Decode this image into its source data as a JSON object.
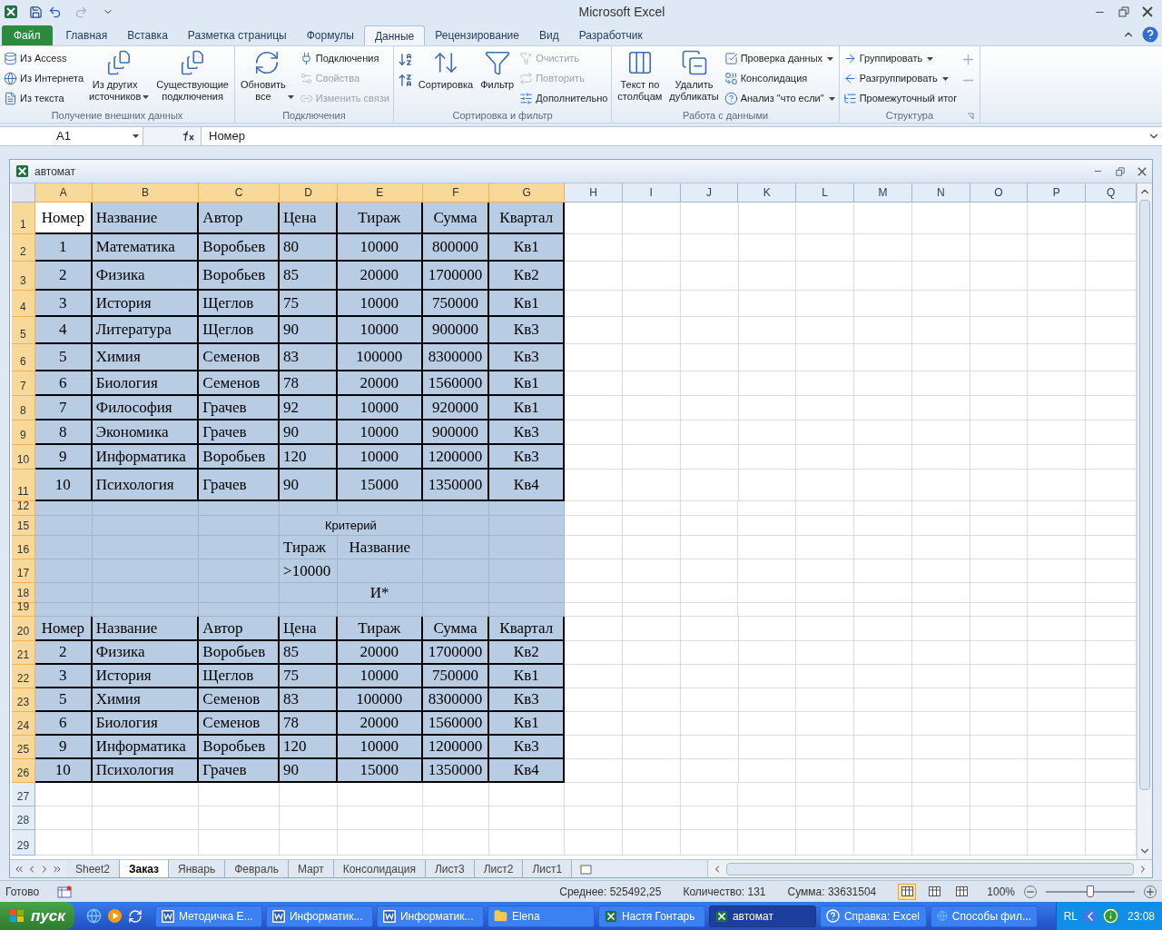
{
  "app": {
    "title": "Microsoft Excel"
  },
  "ribbon": {
    "tabs": [
      {
        "label": "Файл",
        "kind": "file",
        "selected": false
      },
      {
        "label": "Главная",
        "kind": "tab",
        "selected": false
      },
      {
        "label": "Вставка",
        "kind": "tab",
        "selected": false
      },
      {
        "label": "Разметка страницы",
        "kind": "tab",
        "selected": false
      },
      {
        "label": "Формулы",
        "kind": "tab",
        "selected": false
      },
      {
        "label": "Данные",
        "kind": "tab",
        "selected": true
      },
      {
        "label": "Рецензирование",
        "kind": "tab",
        "selected": false
      },
      {
        "label": "Вид",
        "kind": "tab",
        "selected": false
      },
      {
        "label": "Разработчик",
        "kind": "tab",
        "selected": false
      }
    ],
    "groups": [
      {
        "label": "Получение внешних данных",
        "launcher": false,
        "items": [
          {
            "kind": "stack",
            "items": [
              {
                "label": "Из Access",
                "disabled": false,
                "dropdown": false
              },
              {
                "label": "Из Интернета",
                "disabled": false,
                "dropdown": false
              },
              {
                "label": "Из текста",
                "disabled": false,
                "dropdown": false
              }
            ]
          },
          {
            "kind": "large",
            "label": "Из других\nисточников",
            "disabled": false,
            "dropdown": true
          },
          {
            "kind": "large",
            "label": "Существующие\nподключения",
            "disabled": false,
            "dropdown": false
          }
        ]
      },
      {
        "label": "Подключения",
        "launcher": false,
        "items": [
          {
            "kind": "large",
            "label": "Обновить\nвсе",
            "disabled": false,
            "dropdown": true
          },
          {
            "kind": "stack",
            "items": [
              {
                "label": "Подключения",
                "disabled": false,
                "dropdown": false
              },
              {
                "label": "Свойства",
                "disabled": true,
                "dropdown": false
              },
              {
                "label": "Изменить связи",
                "disabled": true,
                "dropdown": false
              }
            ]
          }
        ]
      },
      {
        "label": "Сортировка и фильтр",
        "launcher": false,
        "items": [
          {
            "kind": "icons",
            "items": [
              {
                "disabled": false
              },
              {
                "disabled": false
              }
            ]
          },
          {
            "kind": "large",
            "label": "Сортировка",
            "disabled": false,
            "dropdown": false
          },
          {
            "kind": "large",
            "label": "Фильтр",
            "disabled": false,
            "dropdown": false
          },
          {
            "kind": "stack",
            "items": [
              {
                "label": "Очистить",
                "disabled": true,
                "dropdown": false
              },
              {
                "label": "Повторить",
                "disabled": true,
                "dropdown": false
              },
              {
                "label": "Дополнительно",
                "disabled": false,
                "dropdown": false
              }
            ]
          }
        ]
      },
      {
        "label": "Работа с данными",
        "launcher": false,
        "items": [
          {
            "kind": "large",
            "label": "Текст по\nстолбцам",
            "disabled": false,
            "dropdown": false
          },
          {
            "kind": "large",
            "label": "Удалить\nдубликаты",
            "disabled": false,
            "dropdown": false
          },
          {
            "kind": "stack",
            "items": [
              {
                "label": "Проверка данных",
                "disabled": false,
                "dropdown": true
              },
              {
                "label": "Консолидация",
                "disabled": false,
                "dropdown": false
              },
              {
                "label": "Анализ \"что если\"",
                "disabled": false,
                "dropdown": true
              }
            ]
          }
        ]
      },
      {
        "label": "Структура",
        "launcher": true,
        "items": [
          {
            "kind": "stack",
            "items": [
              {
                "label": "Группировать",
                "disabled": false,
                "dropdown": true
              },
              {
                "label": "Разгруппировать",
                "disabled": false,
                "dropdown": true
              },
              {
                "label": "Промежуточный итог",
                "disabled": false,
                "dropdown": false
              }
            ]
          },
          {
            "kind": "icons",
            "items": [
              {
                "disabled": true
              },
              {
                "disabled": true
              }
            ]
          }
        ]
      }
    ]
  },
  "formula_bar": {
    "name_box": "A1",
    "formula": "Номер"
  },
  "workbook": {
    "title": "автомат",
    "grid": {
      "columns": [
        {
          "label": "A",
          "selected": true
        },
        {
          "label": "B",
          "selected": true
        },
        {
          "label": "C",
          "selected": true
        },
        {
          "label": "D",
          "selected": true
        },
        {
          "label": "E",
          "selected": true
        },
        {
          "label": "F",
          "selected": true
        },
        {
          "label": "G",
          "selected": true
        },
        {
          "label": "H",
          "selected": false
        },
        {
          "label": "I",
          "selected": false
        },
        {
          "label": "J",
          "selected": false
        },
        {
          "label": "K",
          "selected": false
        },
        {
          "label": "L",
          "selected": false
        },
        {
          "label": "M",
          "selected": false
        },
        {
          "label": "N",
          "selected": false
        },
        {
          "label": "O",
          "selected": false
        },
        {
          "label": "P",
          "selected": false
        },
        {
          "label": "Q",
          "selected": false
        }
      ],
      "rows": [
        {
          "label": "1",
          "selected": true,
          "kind": "header",
          "active": true,
          "cells": [
            "Номер",
            "Название",
            "Автор",
            "Цена",
            "Тираж",
            "Сумма",
            "Квартал"
          ]
        },
        {
          "label": "2",
          "selected": true,
          "kind": "data",
          "cells": [
            "1",
            "Математика",
            "Воробьев",
            "80",
            "10000",
            "800000",
            "Кв1"
          ]
        },
        {
          "label": "3",
          "selected": true,
          "kind": "data",
          "cells": [
            "2",
            "Физика",
            "Воробьев",
            "85",
            "20000",
            "1700000",
            "Кв2"
          ]
        },
        {
          "label": "4",
          "selected": true,
          "kind": "data",
          "cells": [
            "3",
            "История",
            "Щеглов",
            "75",
            "10000",
            "750000",
            "Кв1"
          ]
        },
        {
          "label": "5",
          "selected": true,
          "kind": "data",
          "cells": [
            "4",
            "Литература",
            "Щеглов",
            "90",
            "10000",
            "900000",
            "Кв3"
          ]
        },
        {
          "label": "6",
          "selected": true,
          "kind": "data",
          "cells": [
            "5",
            "Химия",
            "Семенов",
            "83",
            "100000",
            "8300000",
            "Кв3"
          ]
        },
        {
          "label": "7",
          "selected": true,
          "kind": "data",
          "cells": [
            "6",
            "Биология",
            "Семенов",
            "78",
            "20000",
            "1560000",
            "Кв1"
          ]
        },
        {
          "label": "8",
          "selected": true,
          "kind": "data",
          "cells": [
            "7",
            "Философия",
            "Грачев",
            "92",
            "10000",
            "920000",
            "Кв1"
          ]
        },
        {
          "label": "9",
          "selected": true,
          "kind": "data",
          "cells": [
            "8",
            "Экономика",
            "Грачев",
            "90",
            "10000",
            "900000",
            "Кв3"
          ]
        },
        {
          "label": "10",
          "selected": true,
          "kind": "data",
          "cells": [
            "9",
            "Информатика",
            "Воробьев",
            "120",
            "10000",
            "1200000",
            "Кв3"
          ]
        },
        {
          "label": "11",
          "selected": true,
          "kind": "data",
          "cells": [
            "10",
            "Психология",
            "Грачев",
            "90",
            "15000",
            "1350000",
            "Кв4"
          ]
        },
        {
          "label": "12",
          "selected": true,
          "kind": "blank"
        },
        {
          "label": "15",
          "selected": true,
          "kind": "caption",
          "cells": [
            null,
            null,
            null,
            "Критерий",
            null,
            null,
            null
          ]
        },
        {
          "label": "16",
          "selected": true,
          "kind": "sparse",
          "cells": [
            null,
            null,
            null,
            "Тираж",
            "Название",
            null,
            null
          ]
        },
        {
          "label": "17",
          "selected": true,
          "kind": "sparse",
          "cells": [
            null,
            null,
            null,
            ">10000",
            null,
            null,
            null
          ]
        },
        {
          "label": "18",
          "selected": true,
          "kind": "sparse",
          "cells": [
            null,
            null,
            null,
            null,
            "И*",
            null,
            null
          ]
        },
        {
          "label": "19",
          "selected": true,
          "kind": "blank"
        },
        {
          "label": "20",
          "selected": true,
          "kind": "header",
          "cells": [
            "Номер",
            "Название",
            "Автор",
            "Цена",
            "Тираж",
            "Сумма",
            "Квартал"
          ]
        },
        {
          "label": "21",
          "selected": true,
          "kind": "data",
          "cells": [
            "2",
            "Физика",
            "Воробьев",
            "85",
            "20000",
            "1700000",
            "Кв2"
          ]
        },
        {
          "label": "22",
          "selected": true,
          "kind": "data",
          "cells": [
            "3",
            "История",
            "Щеглов",
            "75",
            "10000",
            "750000",
            "Кв1"
          ]
        },
        {
          "label": "23",
          "selected": true,
          "kind": "data",
          "cells": [
            "5",
            "Химия",
            "Семенов",
            "83",
            "100000",
            "8300000",
            "Кв3"
          ]
        },
        {
          "label": "24",
          "selected": true,
          "kind": "data",
          "cells": [
            "6",
            "Биология",
            "Семенов",
            "78",
            "20000",
            "1560000",
            "Кв1"
          ]
        },
        {
          "label": "25",
          "selected": true,
          "kind": "data",
          "cells": [
            "9",
            "Информатика",
            "Воробьев",
            "120",
            "10000",
            "1200000",
            "Кв3"
          ]
        },
        {
          "label": "26",
          "selected": true,
          "kind": "data",
          "cells": [
            "10",
            "Психология",
            "Грачев",
            "90",
            "15000",
            "1350000",
            "Кв4"
          ]
        },
        {
          "label": "27",
          "selected": false,
          "kind": "blank"
        },
        {
          "label": "28",
          "selected": false,
          "kind": "blank"
        },
        {
          "label": "29",
          "selected": false,
          "kind": "blank"
        }
      ]
    },
    "sheet_tabs": [
      {
        "label": "Sheet2",
        "selected": false
      },
      {
        "label": "Заказ",
        "selected": true
      },
      {
        "label": "Январь",
        "selected": false
      },
      {
        "label": "Февраль",
        "selected": false
      },
      {
        "label": "Март",
        "selected": false
      },
      {
        "label": "Консолидация",
        "selected": false
      },
      {
        "label": "Лист3",
        "selected": false
      },
      {
        "label": "Лист2",
        "selected": false
      },
      {
        "label": "Лист1",
        "selected": false
      }
    ]
  },
  "status_bar": {
    "ready": "Готово",
    "stats": [
      "Среднее: 525492,25",
      "Количество: 131",
      "Сумма: 33631504"
    ],
    "views": [
      {
        "selected": true
      },
      {
        "selected": false
      },
      {
        "selected": false
      }
    ],
    "zoom": "100%",
    "zoom_slider": {
      "level": 0.5
    }
  },
  "taskbar": {
    "start": "пуск",
    "tasks": [
      {
        "label": "Методичка E...",
        "kind": "document",
        "selected": false
      },
      {
        "label": "Информатик...",
        "kind": "document",
        "selected": false
      },
      {
        "label": "Информатик...",
        "kind": "document",
        "selected": false
      },
      {
        "label": "Elena",
        "kind": "folder",
        "selected": false
      },
      {
        "label": "Настя Гонтарь",
        "kind": "workbook",
        "selected": false
      },
      {
        "label": "автомат",
        "kind": "workbook",
        "selected": true
      },
      {
        "label": "Справка: Excel",
        "kind": "help",
        "selected": false
      },
      {
        "label": "Способы фил...",
        "kind": "browser",
        "selected": false
      }
    ],
    "tray": {
      "language": "RL",
      "time": "23:08"
    }
  }
}
